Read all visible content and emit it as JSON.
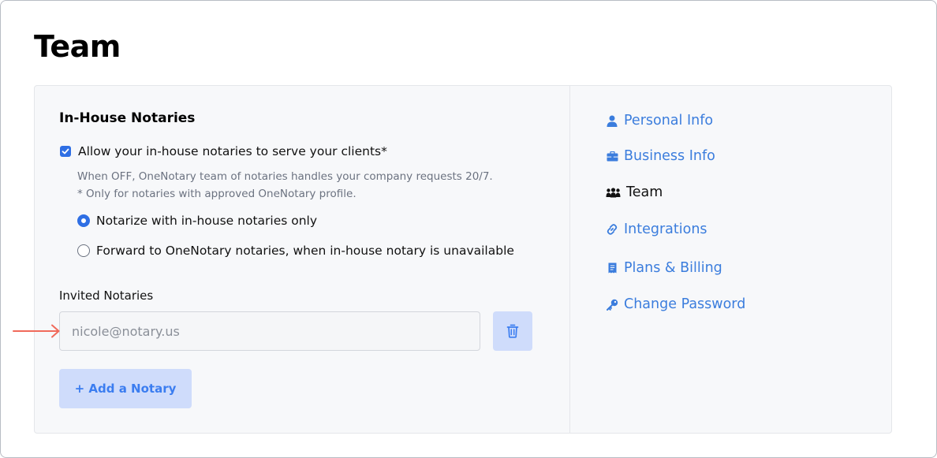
{
  "page": {
    "title": "Team"
  },
  "in_house": {
    "heading": "In-House Notaries",
    "allow_checkbox": {
      "label": "Allow your in-house notaries to serve your clients*",
      "checked": true
    },
    "help_line_1": "When OFF, OneNotary team of notaries handles your company requests 20/7.",
    "help_line_2": "* Only for notaries with approved OneNotary profile.",
    "radio_options": [
      {
        "label": "Notarize with in-house notaries only",
        "selected": true
      },
      {
        "label": "Forward to OneNotary notaries, when in-house notary is unavailable",
        "selected": false
      }
    ]
  },
  "invited": {
    "label": "Invited Notaries",
    "email_placeholder": "nicole@notary.us",
    "add_button": "+ Add a Notary"
  },
  "nav": {
    "items": [
      {
        "label": "Personal Info",
        "icon": "user-icon",
        "active": false
      },
      {
        "label": "Business Info",
        "icon": "briefcase-icon",
        "active": false
      },
      {
        "label": "Team",
        "icon": "team-icon",
        "active": true
      },
      {
        "label": "Integrations",
        "icon": "link-icon",
        "active": false
      },
      {
        "label": "Plans & Billing",
        "icon": "receipt-icon",
        "active": false
      },
      {
        "label": "Change Password",
        "icon": "key-icon",
        "active": false
      }
    ]
  },
  "colors": {
    "accent": "#2f6fe4",
    "nav_link": "#3b7ddd",
    "button_bg": "#cfdcfb",
    "annotation_arrow": "#f06a5b"
  }
}
